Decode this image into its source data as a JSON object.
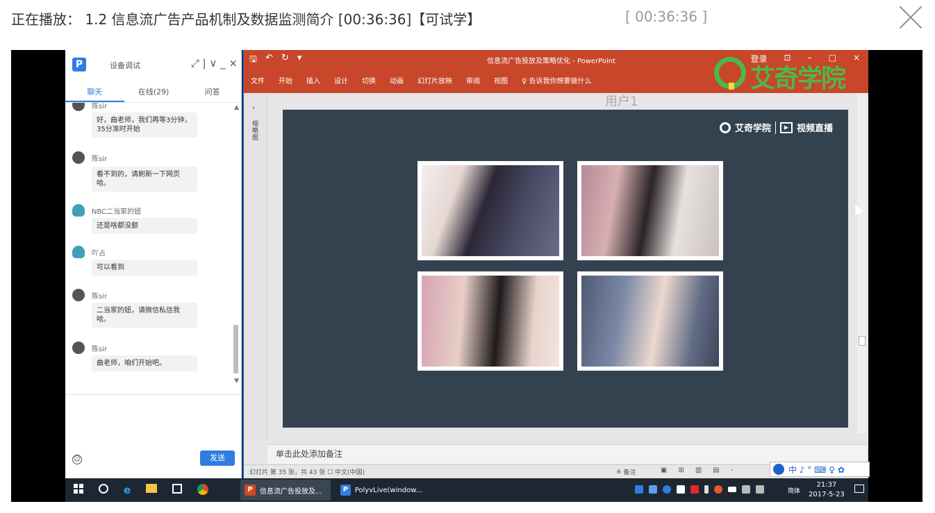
{
  "header": {
    "now_playing": "正在播放： 1.2 信息流广告产品机制及数据监测简介 [00:36:36]【可试学】",
    "time_display": "[ 00:36:36 ]"
  },
  "chat": {
    "window_title": "设备调试",
    "logo_letter": "P",
    "title_controls": "⤢  |  ∨  _  ×",
    "tabs": [
      {
        "label": "聊天"
      },
      {
        "label": "在线(29)"
      },
      {
        "label": "问答"
      }
    ],
    "messages": [
      {
        "sender": "陈sir",
        "text": "好，曲老师，我们再等3分钟，35分准时开始"
      },
      {
        "sender": "陈sir",
        "text": "看不到的，请刷新一下网页哈。"
      },
      {
        "sender": "NBC二当家的妞",
        "text": "还是啥都没额"
      },
      {
        "sender": "吖占",
        "text": "可以看到"
      },
      {
        "sender": "陈sir",
        "text": "二当家的妞，请微信私信我哈。"
      },
      {
        "sender": "陈sir",
        "text": "曲老师，咱们开始吧。"
      }
    ],
    "send_label": "发送",
    "emoji_icon": "☺"
  },
  "ppt": {
    "title": "信息流广告投放及策略优化 - PowerPoint",
    "login": "登录",
    "qat": [
      "🖫",
      "↶",
      "↻",
      "▾"
    ],
    "window_controls": [
      "⊡",
      "–",
      "□",
      "×"
    ],
    "ribbon_tabs": [
      "文件",
      "开始",
      "插入",
      "设计",
      "切换",
      "动画",
      "幻灯片放映",
      "审阅",
      "视图",
      "♀ 告诉我你想要做什么"
    ],
    "brand_text": "艾奇学院",
    "thumb_label": "缩略图",
    "user_label": "用户1",
    "slide_logo_text": "艾奇学院",
    "slide_logo_sub": "视频直播",
    "notes_placeholder": "单击此处添加备注",
    "status_left": "幻灯片 第 35 张，共 43 张   ☐   中文(中国)",
    "status_notes": "≜ 备注",
    "status_views": [
      "▣",
      "⊞",
      "▥",
      "▤",
      "-"
    ],
    "ime_text": "中 ♪ ° ⌨ ♀ ✿"
  },
  "taskbar": {
    "apps": [
      {
        "icon_letter": "P",
        "label": "信息流广告投放及..."
      },
      {
        "icon_letter": "P",
        "label": "PolyvLive(window..."
      }
    ],
    "ime_label": "简体",
    "clock_time": "21:37",
    "clock_date": "2017-5-23"
  },
  "colors": {
    "ppt_red": "#c8462a",
    "accent_blue": "#2f7de1",
    "brand_green": "#4cb84c",
    "slide_bg": "#344250",
    "taskbar": "#1d2733"
  }
}
